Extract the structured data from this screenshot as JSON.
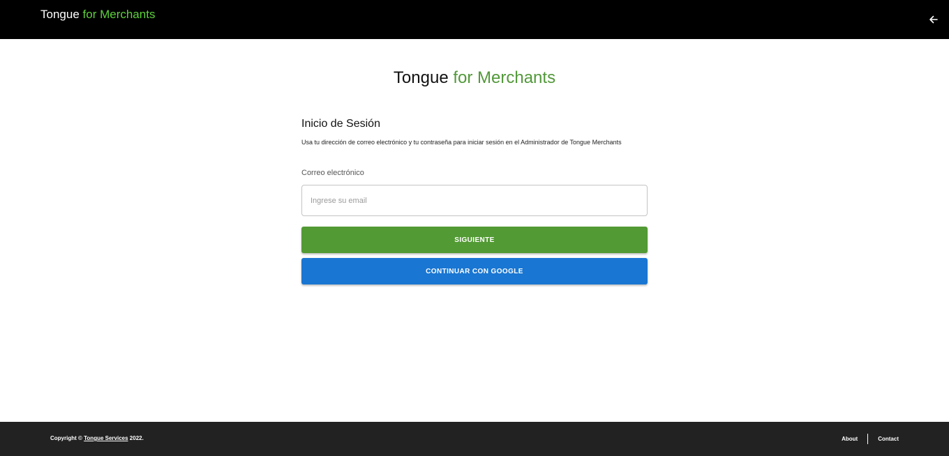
{
  "header": {
    "brand_main": "Tongue",
    "brand_accent": "for Merchants",
    "back_icon": "arrow-left-icon"
  },
  "page_title": {
    "main": "Tongue",
    "accent": "for Merchants"
  },
  "login": {
    "title": "Inicio de Sesión",
    "description": "Usa tu dirección de correo electrónico y tu contraseña para iniciar sesión en el Administrador de Tongue Merchants",
    "email_label": "Correo electrónico",
    "email_value": "",
    "email_placeholder": "Ingrese su email",
    "next_label": "SIGUIENTE",
    "google_label": "CONTINUAR CON GOOGLE"
  },
  "footer": {
    "copyright_prefix": "Copyright ©",
    "company_link": "Tongue Services",
    "year": "2022.",
    "links": [
      "About",
      "Contact"
    ]
  },
  "colors": {
    "header_bg": "#000000",
    "brand_accent": "#5cd13a",
    "title_accent": "#52983a",
    "next_button": "#529a33",
    "google_button": "#1976d2",
    "footer_bg": "#222222"
  }
}
